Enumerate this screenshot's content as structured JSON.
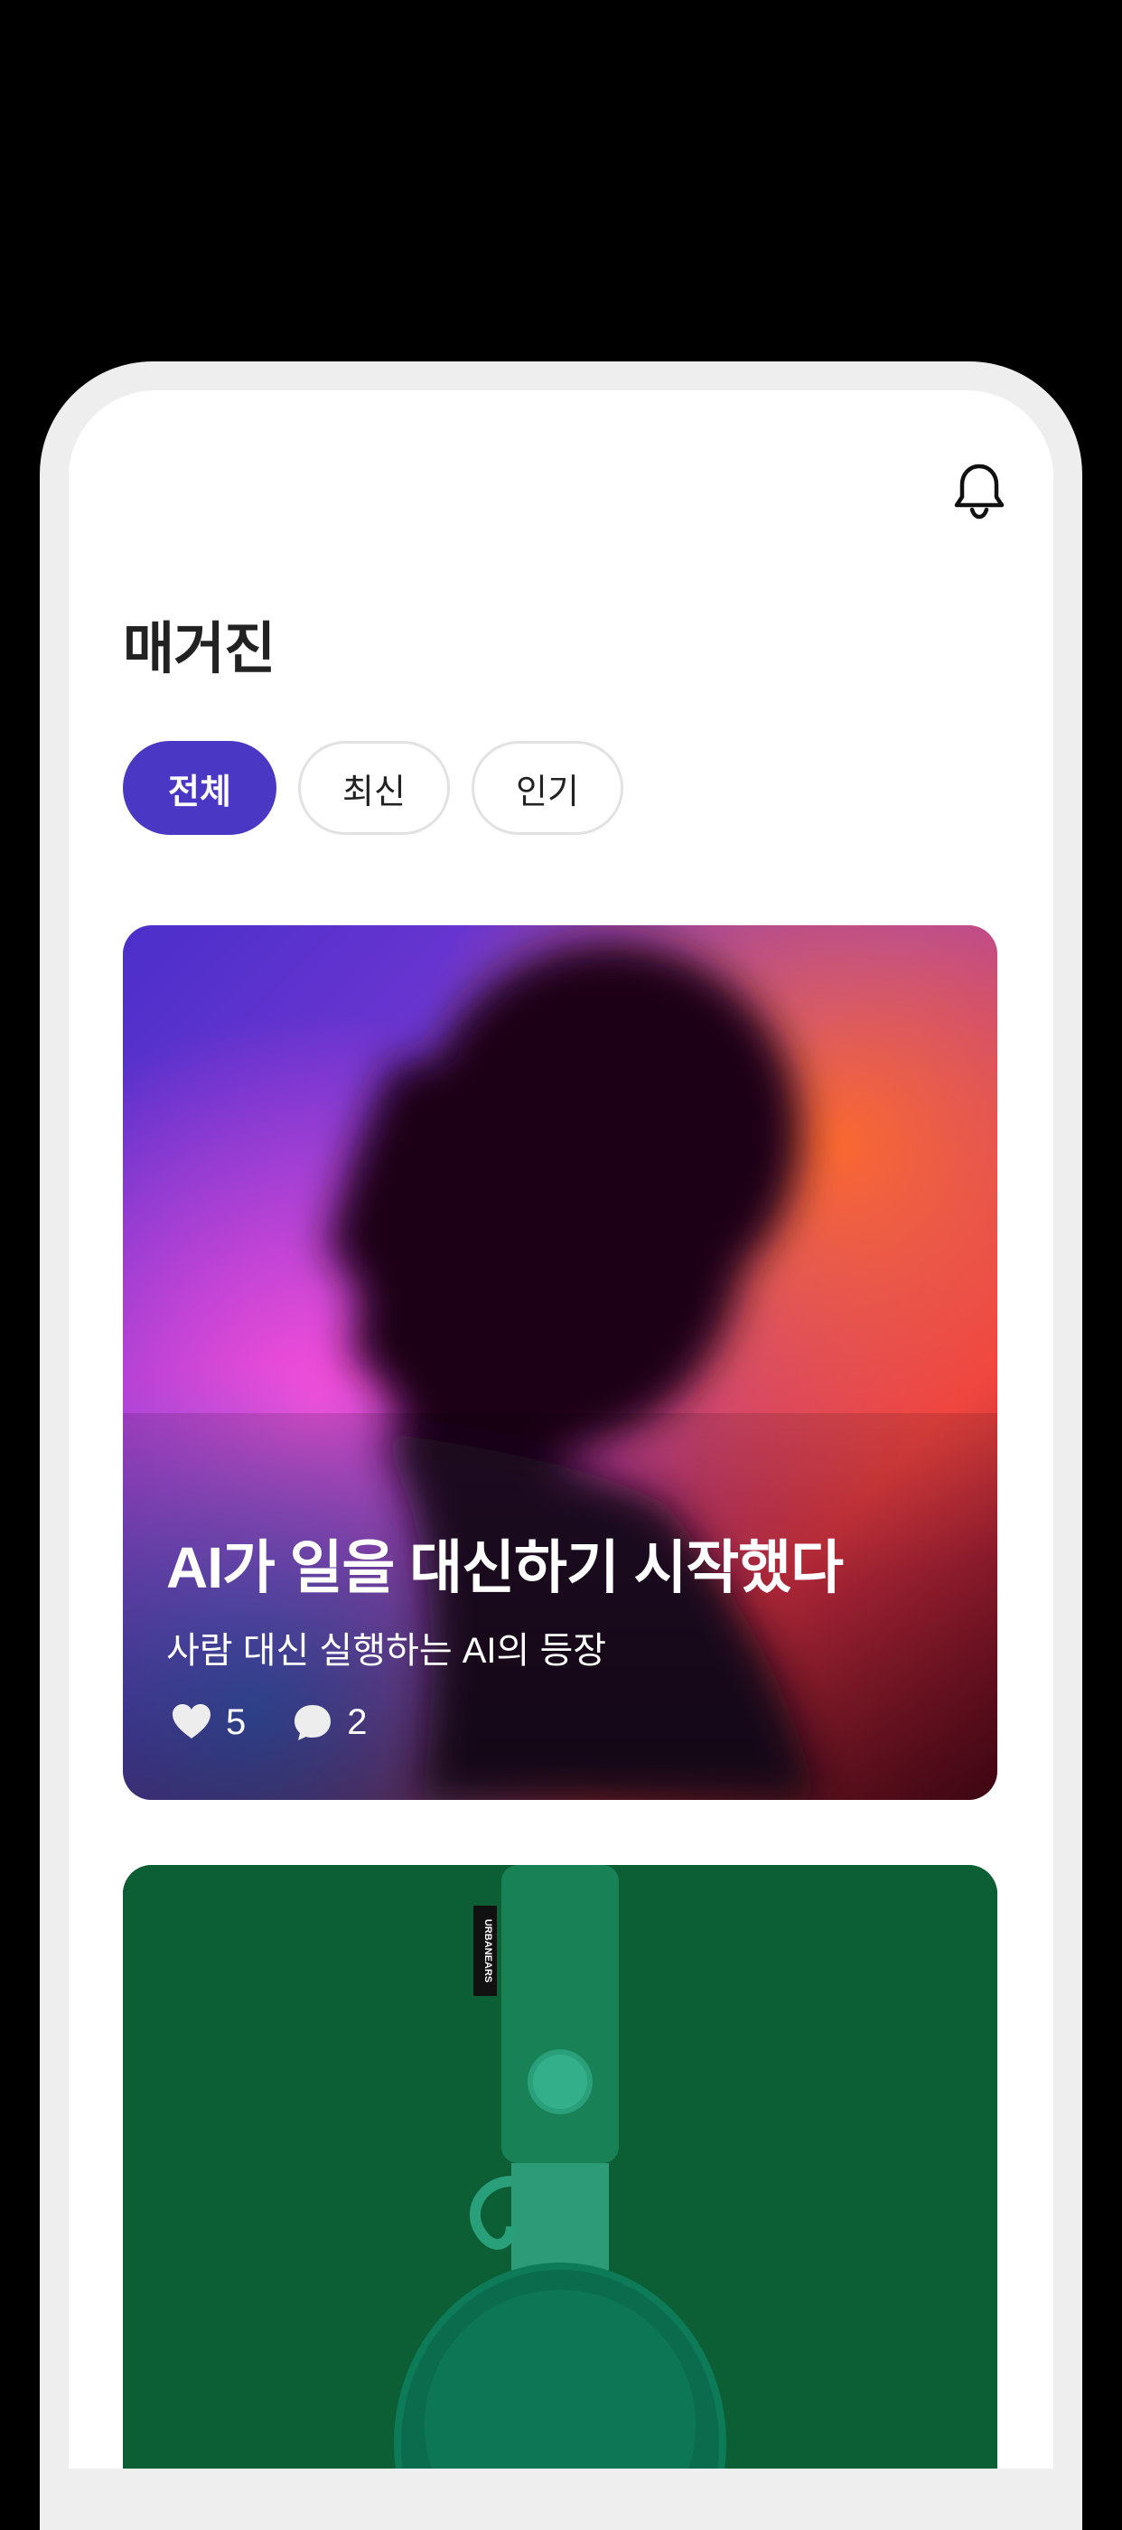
{
  "header": {
    "bell_icon": "bell-icon",
    "title": "매거진"
  },
  "tabs": [
    {
      "label": "전체",
      "active": true
    },
    {
      "label": "최신",
      "active": false
    },
    {
      "label": "인기",
      "active": false
    }
  ],
  "colors": {
    "accent": "#4a38c4",
    "card2_bg": "#0c5e34"
  },
  "articles": [
    {
      "title": "AI가 일을 대신하기 시작했다",
      "subtitle": "사람 대신 실행하는 AI의 등장",
      "likes": "5",
      "comments": "2"
    },
    {
      "brand": "URBANEARS"
    }
  ]
}
